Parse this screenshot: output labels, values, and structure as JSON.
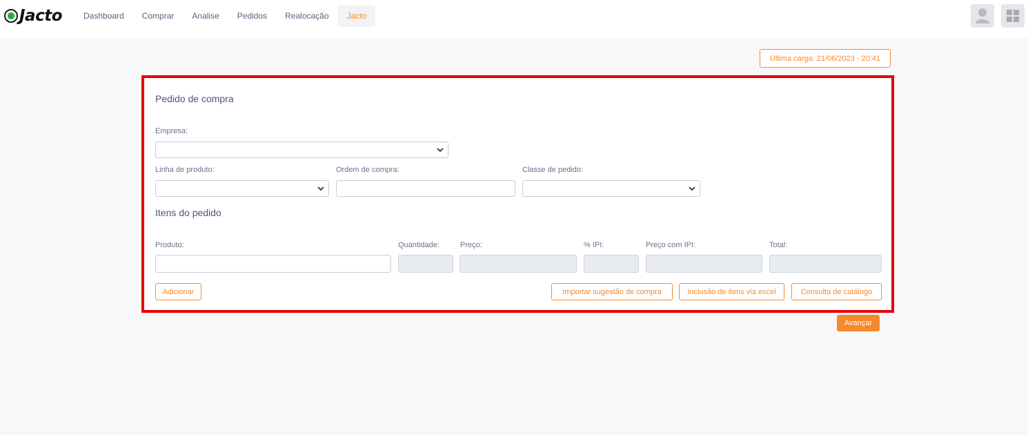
{
  "brand": {
    "name": "Jacto"
  },
  "nav": {
    "items": [
      {
        "label": "Dashboard",
        "active": false
      },
      {
        "label": "Comprar",
        "active": false
      },
      {
        "label": "Analise",
        "active": false
      },
      {
        "label": "Pedidos",
        "active": false
      },
      {
        "label": "Realocação",
        "active": false
      },
      {
        "label": "Jacto",
        "active": true
      }
    ]
  },
  "header": {
    "user_icon": "user-avatar-icon",
    "apps_icon": "grid-apps-icon"
  },
  "status": {
    "last_load": "Última carga: 21/06/2023 - 20:41"
  },
  "form": {
    "title": "Pedido de compra",
    "empresa": {
      "label": "Empresa:",
      "value": ""
    },
    "linha": {
      "label": "Linha de produto:",
      "value": ""
    },
    "ordem": {
      "label": "Ordem de compra:",
      "value": ""
    },
    "classe": {
      "label": "Classe de pedido:",
      "value": ""
    }
  },
  "items": {
    "title": "Itens do pedido",
    "produto_label": "Produto:",
    "quantidade_label": "Quantidade:",
    "preco_label": "Preço:",
    "ipi_label": "% IPI:",
    "preco_ipi_label": "Preço com IPI:",
    "total_label": "Total:",
    "add_button": "Adicionar",
    "import_button": "Importar sugestão de compra",
    "excel_button": "Inclusão de itens via excel",
    "catalog_button": "Consulta de catálogo"
  },
  "footer": {
    "next_button": "Avançar"
  },
  "colors": {
    "accent": "#f58a2d",
    "highlight": "#e60000",
    "text": "#5a5f7d"
  }
}
